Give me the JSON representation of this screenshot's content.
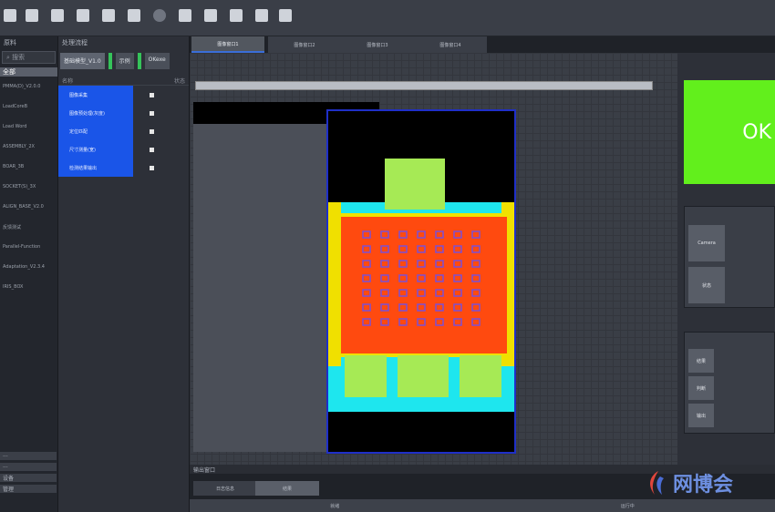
{
  "toolbar": {
    "icons": [
      "save-icon",
      "open-icon",
      "folder-icon",
      "device-icon",
      "upload-icon",
      "download-icon",
      "circle-icon",
      "grid-icon",
      "stack-icon",
      "move-icon",
      "zoom-in-icon",
      "zoom-out-icon"
    ]
  },
  "sidebar_left": {
    "title": "原料",
    "search_placeholder": "搜索",
    "selected": "全部",
    "items": [
      "PMMA(D)_V2.0.0",
      "LoadCoreB",
      "Load Word",
      "ASSEMBLY_2X",
      "BOAR_3B",
      "SOCKET(S)_3X",
      "ALIGN_BASE_V2.0",
      "反馈测试",
      "Parallel-Function",
      "Adaptation_V2.3.4",
      "IRIS_BOX"
    ],
    "bottom_items": [
      "...",
      "...",
      "设备",
      "管理"
    ]
  },
  "sidebar_mid": {
    "title": "处理流程",
    "tab1": "基础模型_V1.0",
    "tab2": "示例",
    "tab3": "OKexe",
    "header_left": "名称",
    "header_right": "状态",
    "rows": [
      "图像采集",
      "图像预处理(灰度)",
      "定位匹配",
      "尺寸测量(宽)",
      "检测结果输出"
    ]
  },
  "tabs_top": [
    "图像窗口1",
    "图像窗口2",
    "图像窗口3",
    "图像窗口4"
  ],
  "ok_label": "OK",
  "right_table1": {
    "labels": [
      "Camera",
      "状态"
    ]
  },
  "right_table2": {
    "labels": [
      "结果",
      "判断",
      "输出"
    ]
  },
  "bottom": {
    "title": "输出窗口",
    "tabs": [
      "日志信息",
      "结果"
    ],
    "status_left": "就绪",
    "status_right": "运行中"
  },
  "watermark": "网博会",
  "colors": {
    "accent_blue": "#1a55e8",
    "ok_green": "#62ef1c",
    "board_border": "#1f2fc8",
    "orange": "#ff4a0f",
    "cyan": "#1ee6ee",
    "yellow": "#f0e000",
    "lime": "#a6ea55",
    "pad_purple": "#7a4fd6"
  }
}
